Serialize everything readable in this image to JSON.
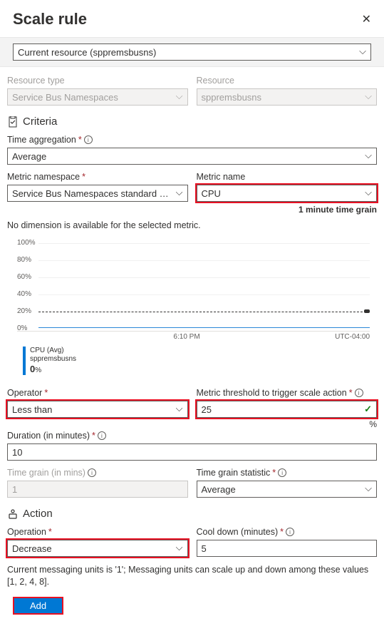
{
  "header": {
    "title": "Scale rule"
  },
  "top_select": {
    "value": "Current resource (sppremsbusns)"
  },
  "resource": {
    "type_label": "Resource type",
    "type_value": "Service Bus Namespaces",
    "res_label": "Resource",
    "res_value": "sppremsbusns"
  },
  "criteria": {
    "heading": "Criteria",
    "time_agg_label": "Time aggregation",
    "time_agg_value": "Average",
    "ns_label": "Metric namespace",
    "ns_value": "Service Bus Namespaces standard me...",
    "metric_label": "Metric name",
    "metric_value": "CPU",
    "time_grain_note": "1 minute time grain",
    "dim_msg": "No dimension is available for the selected metric.",
    "operator_label": "Operator",
    "operator_value": "Less than",
    "threshold_label": "Metric threshold to trigger scale action",
    "threshold_value": "25",
    "threshold_unit": "%",
    "duration_label": "Duration (in minutes)",
    "duration_value": "10",
    "tg_label": "Time grain (in mins)",
    "tg_value": "1",
    "tgs_label": "Time grain statistic",
    "tgs_value": "Average"
  },
  "chart_data": {
    "type": "line",
    "ylim": [
      0,
      100
    ],
    "yticks": [
      "100%",
      "80%",
      "60%",
      "40%",
      "20%",
      "0%"
    ],
    "threshold_pct": 20,
    "xticks_left": "",
    "xticks_mid": "6:10 PM",
    "xticks_right": "UTC-04:00",
    "legend_title": "CPU (Avg)",
    "legend_sub": "sppremsbusns",
    "legend_value": "0",
    "legend_unit": "%"
  },
  "action": {
    "heading": "Action",
    "op_label": "Operation",
    "op_value": "Decrease",
    "cd_label": "Cool down (minutes)",
    "cd_value": "5",
    "note": "Current messaging units is '1'; Messaging units can scale up and down among these values [1, 2, 4, 8].",
    "add_label": "Add"
  }
}
